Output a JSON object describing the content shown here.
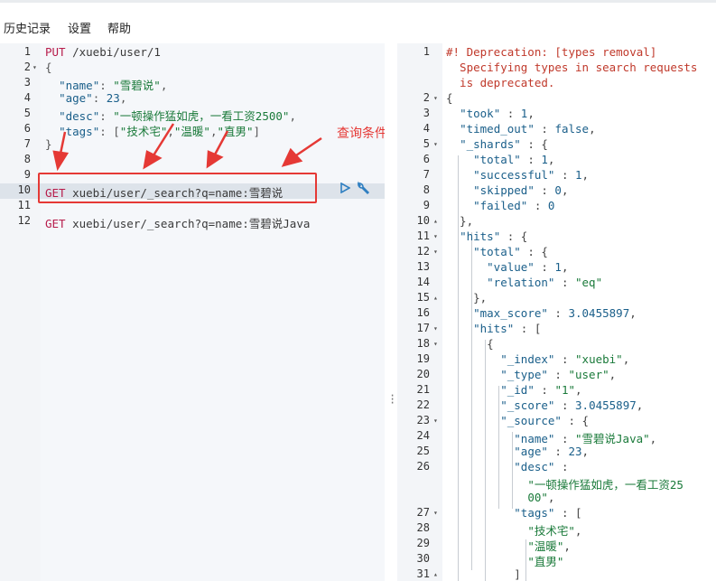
{
  "menu": {
    "history": "历史记录",
    "settings": "设置",
    "help": "帮助"
  },
  "editor": {
    "lines": [
      {
        "n": "1",
        "fold": "",
        "parts": [
          [
            "m",
            "PUT"
          ],
          [
            "u",
            " /xuebi/user/1"
          ]
        ]
      },
      {
        "n": "2",
        "fold": "▾",
        "parts": [
          [
            "p",
            "{"
          ]
        ]
      },
      {
        "n": "3",
        "fold": "",
        "parts": [
          [
            "p",
            "  "
          ],
          [
            "k",
            "\"name\""
          ],
          [
            "p",
            ": "
          ],
          [
            "s",
            "\"雪碧说\""
          ],
          [
            "p",
            ","
          ]
        ]
      },
      {
        "n": "4",
        "fold": "",
        "parts": [
          [
            "p",
            "  "
          ],
          [
            "k",
            "\"age\""
          ],
          [
            "p",
            ": "
          ],
          [
            "n",
            "23"
          ],
          [
            "p",
            ","
          ]
        ]
      },
      {
        "n": "5",
        "fold": "",
        "parts": [
          [
            "p",
            "  "
          ],
          [
            "k",
            "\"desc\""
          ],
          [
            "p",
            ": "
          ],
          [
            "s",
            "\"一顿操作猛如虎，一看工资2500\""
          ],
          [
            "p",
            ","
          ]
        ]
      },
      {
        "n": "6",
        "fold": "",
        "parts": [
          [
            "p",
            "  "
          ],
          [
            "k",
            "\"tags\""
          ],
          [
            "p",
            ": ["
          ],
          [
            "s",
            "\"技术宅\""
          ],
          [
            "p",
            ","
          ],
          [
            "s",
            "\"温暖\""
          ],
          [
            "p",
            ","
          ],
          [
            "s",
            "\"直男\""
          ],
          [
            "p",
            "]"
          ]
        ]
      },
      {
        "n": "7",
        "fold": "",
        "parts": [
          [
            "p",
            "}"
          ]
        ]
      },
      {
        "n": "8",
        "fold": "",
        "parts": []
      },
      {
        "n": "9",
        "fold": "",
        "parts": []
      },
      {
        "n": "10",
        "fold": "",
        "parts": [
          [
            "m",
            "GET"
          ],
          [
            "u",
            " xuebi/user/_search?q=name:雪碧说"
          ]
        ]
      },
      {
        "n": "11",
        "fold": "",
        "parts": []
      },
      {
        "n": "12",
        "fold": "",
        "parts": [
          [
            "m",
            "GET"
          ],
          [
            "u",
            " xuebi/user/_search?q=name:雪碧说Java"
          ]
        ]
      }
    ],
    "highlight_line": 10,
    "annotation": "查询条件"
  },
  "output": {
    "lines": [
      {
        "n": "1",
        "fold": "",
        "parts": [
          [
            "c",
            "#! Deprecation: [types removal]"
          ]
        ]
      },
      {
        "n": "",
        "fold": "",
        "parts": [
          [
            "c",
            "  Specifying types in search requests"
          ]
        ]
      },
      {
        "n": "",
        "fold": "",
        "parts": [
          [
            "c",
            "  is deprecated."
          ]
        ]
      },
      {
        "n": "2",
        "fold": "▾",
        "parts": [
          [
            "p",
            "{"
          ]
        ]
      },
      {
        "n": "3",
        "fold": "",
        "parts": [
          [
            "p",
            "  "
          ],
          [
            "k",
            "\"took\""
          ],
          [
            "p",
            " : "
          ],
          [
            "n",
            "1"
          ],
          [
            "p",
            ","
          ]
        ]
      },
      {
        "n": "4",
        "fold": "",
        "parts": [
          [
            "p",
            "  "
          ],
          [
            "k",
            "\"timed_out\""
          ],
          [
            "p",
            " : "
          ],
          [
            "n",
            "false"
          ],
          [
            "p",
            ","
          ]
        ]
      },
      {
        "n": "5",
        "fold": "▾",
        "parts": [
          [
            "p",
            "  "
          ],
          [
            "k",
            "\"_shards\""
          ],
          [
            "p",
            " : {"
          ]
        ]
      },
      {
        "n": "6",
        "fold": "",
        "parts": [
          [
            "p",
            "    "
          ],
          [
            "k",
            "\"total\""
          ],
          [
            "p",
            " : "
          ],
          [
            "n",
            "1"
          ],
          [
            "p",
            ","
          ]
        ]
      },
      {
        "n": "7",
        "fold": "",
        "parts": [
          [
            "p",
            "    "
          ],
          [
            "k",
            "\"successful\""
          ],
          [
            "p",
            " : "
          ],
          [
            "n",
            "1"
          ],
          [
            "p",
            ","
          ]
        ]
      },
      {
        "n": "8",
        "fold": "",
        "parts": [
          [
            "p",
            "    "
          ],
          [
            "k",
            "\"skipped\""
          ],
          [
            "p",
            " : "
          ],
          [
            "n",
            "0"
          ],
          [
            "p",
            ","
          ]
        ]
      },
      {
        "n": "9",
        "fold": "",
        "parts": [
          [
            "p",
            "    "
          ],
          [
            "k",
            "\"failed\""
          ],
          [
            "p",
            " : "
          ],
          [
            "n",
            "0"
          ]
        ]
      },
      {
        "n": "10",
        "fold": "▴",
        "parts": [
          [
            "p",
            "  },"
          ]
        ]
      },
      {
        "n": "11",
        "fold": "▾",
        "parts": [
          [
            "p",
            "  "
          ],
          [
            "k",
            "\"hits\""
          ],
          [
            "p",
            " : {"
          ]
        ]
      },
      {
        "n": "12",
        "fold": "▾",
        "parts": [
          [
            "p",
            "    "
          ],
          [
            "k",
            "\"total\""
          ],
          [
            "p",
            " : {"
          ]
        ]
      },
      {
        "n": "13",
        "fold": "",
        "parts": [
          [
            "p",
            "      "
          ],
          [
            "k",
            "\"value\""
          ],
          [
            "p",
            " : "
          ],
          [
            "n",
            "1"
          ],
          [
            "p",
            ","
          ]
        ]
      },
      {
        "n": "14",
        "fold": "",
        "parts": [
          [
            "p",
            "      "
          ],
          [
            "k",
            "\"relation\""
          ],
          [
            "p",
            " : "
          ],
          [
            "s",
            "\"eq\""
          ]
        ]
      },
      {
        "n": "15",
        "fold": "▴",
        "parts": [
          [
            "p",
            "    },"
          ]
        ]
      },
      {
        "n": "16",
        "fold": "",
        "parts": [
          [
            "p",
            "    "
          ],
          [
            "k",
            "\"max_score\""
          ],
          [
            "p",
            " : "
          ],
          [
            "n",
            "3.0455897"
          ],
          [
            "p",
            ","
          ]
        ]
      },
      {
        "n": "17",
        "fold": "▾",
        "parts": [
          [
            "p",
            "    "
          ],
          [
            "k",
            "\"hits\""
          ],
          [
            "p",
            " : ["
          ]
        ]
      },
      {
        "n": "18",
        "fold": "▾",
        "parts": [
          [
            "p",
            "      {"
          ]
        ]
      },
      {
        "n": "19",
        "fold": "",
        "parts": [
          [
            "p",
            "        "
          ],
          [
            "k",
            "\"_index\""
          ],
          [
            "p",
            " : "
          ],
          [
            "s",
            "\"xuebi\""
          ],
          [
            "p",
            ","
          ]
        ]
      },
      {
        "n": "20",
        "fold": "",
        "parts": [
          [
            "p",
            "        "
          ],
          [
            "k",
            "\"_type\""
          ],
          [
            "p",
            " : "
          ],
          [
            "s",
            "\"user\""
          ],
          [
            "p",
            ","
          ]
        ]
      },
      {
        "n": "21",
        "fold": "",
        "parts": [
          [
            "p",
            "        "
          ],
          [
            "k",
            "\"_id\""
          ],
          [
            "p",
            " : "
          ],
          [
            "s",
            "\"1\""
          ],
          [
            "p",
            ","
          ]
        ]
      },
      {
        "n": "22",
        "fold": "",
        "parts": [
          [
            "p",
            "        "
          ],
          [
            "k",
            "\"_score\""
          ],
          [
            "p",
            " : "
          ],
          [
            "n",
            "3.0455897"
          ],
          [
            "p",
            ","
          ]
        ]
      },
      {
        "n": "23",
        "fold": "▾",
        "parts": [
          [
            "p",
            "        "
          ],
          [
            "k",
            "\"_source\""
          ],
          [
            "p",
            " : {"
          ]
        ]
      },
      {
        "n": "24",
        "fold": "",
        "parts": [
          [
            "p",
            "          "
          ],
          [
            "k",
            "\"name\""
          ],
          [
            "p",
            " : "
          ],
          [
            "s",
            "\"雪碧说Java\""
          ],
          [
            "p",
            ","
          ]
        ]
      },
      {
        "n": "25",
        "fold": "",
        "parts": [
          [
            "p",
            "          "
          ],
          [
            "k",
            "\"age\""
          ],
          [
            "p",
            " : "
          ],
          [
            "n",
            "23"
          ],
          [
            "p",
            ","
          ]
        ]
      },
      {
        "n": "26",
        "fold": "",
        "parts": [
          [
            "p",
            "          "
          ],
          [
            "k",
            "\"desc\""
          ],
          [
            "p",
            " :"
          ]
        ]
      },
      {
        "n": "",
        "fold": "",
        "parts": [
          [
            "p",
            "            "
          ],
          [
            "s",
            "\"一顿操作猛如虎，一看工资25"
          ]
        ]
      },
      {
        "n": "",
        "fold": "",
        "parts": [
          [
            "p",
            "            "
          ],
          [
            "s",
            "00\""
          ],
          [
            "p",
            ","
          ]
        ]
      },
      {
        "n": "27",
        "fold": "▾",
        "parts": [
          [
            "p",
            "          "
          ],
          [
            "k",
            "\"tags\""
          ],
          [
            "p",
            " : ["
          ]
        ]
      },
      {
        "n": "28",
        "fold": "",
        "parts": [
          [
            "p",
            "            "
          ],
          [
            "s",
            "\"技术宅\""
          ],
          [
            "p",
            ","
          ]
        ]
      },
      {
        "n": "29",
        "fold": "",
        "parts": [
          [
            "p",
            "            "
          ],
          [
            "s",
            "\"温暖\""
          ],
          [
            "p",
            ","
          ]
        ]
      },
      {
        "n": "30",
        "fold": "",
        "parts": [
          [
            "p",
            "            "
          ],
          [
            "s",
            "\"直男\""
          ]
        ]
      },
      {
        "n": "31",
        "fold": "▴",
        "parts": [
          [
            "p",
            "          ]"
          ]
        ]
      }
    ]
  },
  "colors": {
    "annotation": "#e53935",
    "method": "#b71c4b",
    "string": "#1a7a3a",
    "key": "#1a5f8a",
    "comment": "#c0392b"
  },
  "icons": {
    "run": "play-icon",
    "settings": "wrench-icon",
    "resize": "drag-handle-icon"
  }
}
